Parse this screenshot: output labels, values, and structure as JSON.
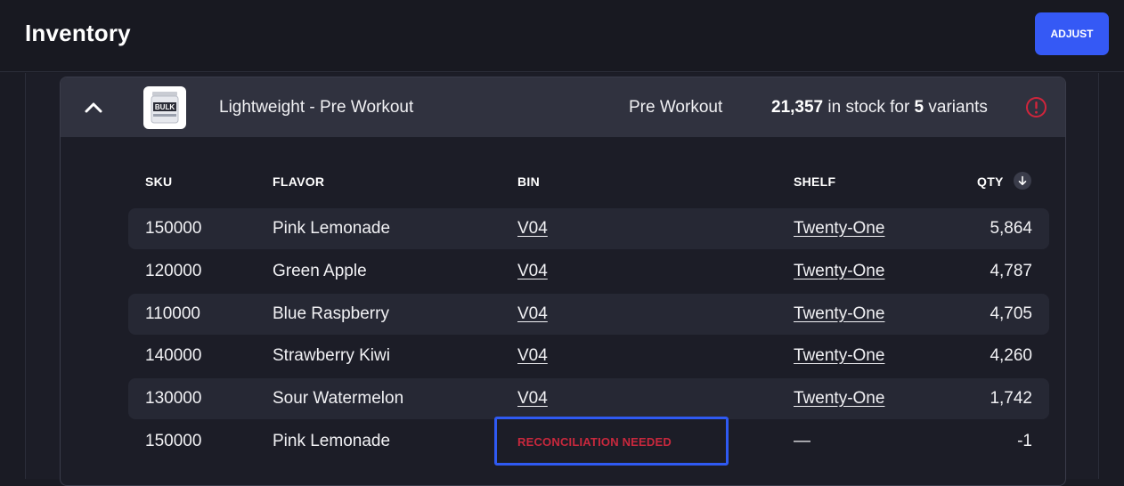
{
  "header": {
    "title": "Inventory",
    "adjust_label": "ADJUST"
  },
  "product": {
    "name": "Lightweight - Pre Workout",
    "category": "Pre Workout",
    "thumbnail_text": "BULK",
    "stock_total": "21,357",
    "stock_mid": " in stock for ",
    "variant_count": "5",
    "stock_suffix": " variants",
    "alert_icon": "alert-circle-icon",
    "collapse_icon": "chevron-up-icon"
  },
  "table": {
    "columns": [
      "SKU",
      "FLAVOR",
      "BIN",
      "SHELF",
      "QTY"
    ],
    "sort_icon": "arrow-down-icon",
    "rows": [
      {
        "sku": "150000",
        "flavor": "Pink Lemonade",
        "bin": "V04",
        "shelf": "Twenty-One",
        "qty": "5,864"
      },
      {
        "sku": "120000",
        "flavor": "Green Apple",
        "bin": "V04",
        "shelf": "Twenty-One",
        "qty": "4,787"
      },
      {
        "sku": "110000",
        "flavor": "Blue Raspberry",
        "bin": "V04",
        "shelf": "Twenty-One",
        "qty": "4,705"
      },
      {
        "sku": "140000",
        "flavor": "Strawberry Kiwi",
        "bin": "V04",
        "shelf": "Twenty-One",
        "qty": "4,260"
      },
      {
        "sku": "130000",
        "flavor": "Sour Watermelon",
        "bin": "V04",
        "shelf": "Twenty-One",
        "qty": "1,742"
      },
      {
        "sku": "150000",
        "flavor": "Pink Lemonade",
        "bin": "RECONCILIATION NEEDED",
        "shelf": "—",
        "qty": "-1"
      }
    ]
  },
  "colors": {
    "accent": "#3559f5",
    "warning": "#c8283d",
    "card_header": "#30323f",
    "row_stripe": "#262834"
  }
}
